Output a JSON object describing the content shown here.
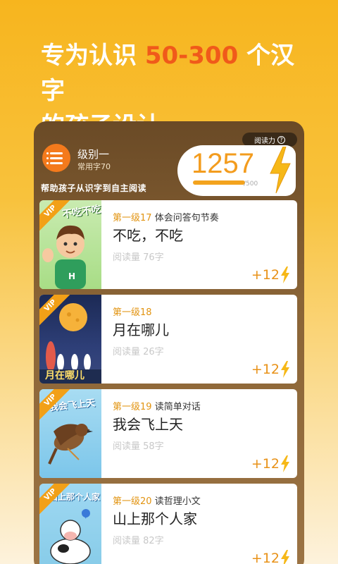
{
  "headline": {
    "prefix": "专为认识 ",
    "highlight": "50-300",
    "suffix": " 个汉字",
    "line2": "的孩子设计"
  },
  "level": {
    "title": "级别一",
    "subtitle": "常用字70",
    "slogan": "帮助孩子从识字到自主阅读"
  },
  "reading": {
    "tab_label": "阅读力",
    "score": "1257",
    "max": "/500",
    "progress": 1.0
  },
  "books": [
    {
      "level": "第一级17",
      "topic": "体会问答句节奏",
      "title": "不吃，不吃",
      "words": "阅读量 76字",
      "reward": "+12",
      "badge": "VIP",
      "cover_text": "不吃不吃"
    },
    {
      "level": "第一级18",
      "topic": "",
      "title": "月在哪儿",
      "words": "阅读量 26字",
      "reward": "+12",
      "badge": "VIP",
      "cover_text": "月在哪儿"
    },
    {
      "level": "第一级19",
      "topic": "读简单对话",
      "title": "我会飞上天",
      "words": "阅读量 58字",
      "reward": "+12",
      "badge": "VIP",
      "cover_text": "我会飞上天"
    },
    {
      "level": "第一级20",
      "topic": "读哲理小文",
      "title": "山上那个人家",
      "words": "阅读量 82字",
      "reward": "+12",
      "badge": "VIP",
      "cover_text": "山上那个人家"
    }
  ],
  "colors": {
    "accent": "#f05a1a",
    "gold": "#f39c1e",
    "card_brown": "#7a5630"
  }
}
